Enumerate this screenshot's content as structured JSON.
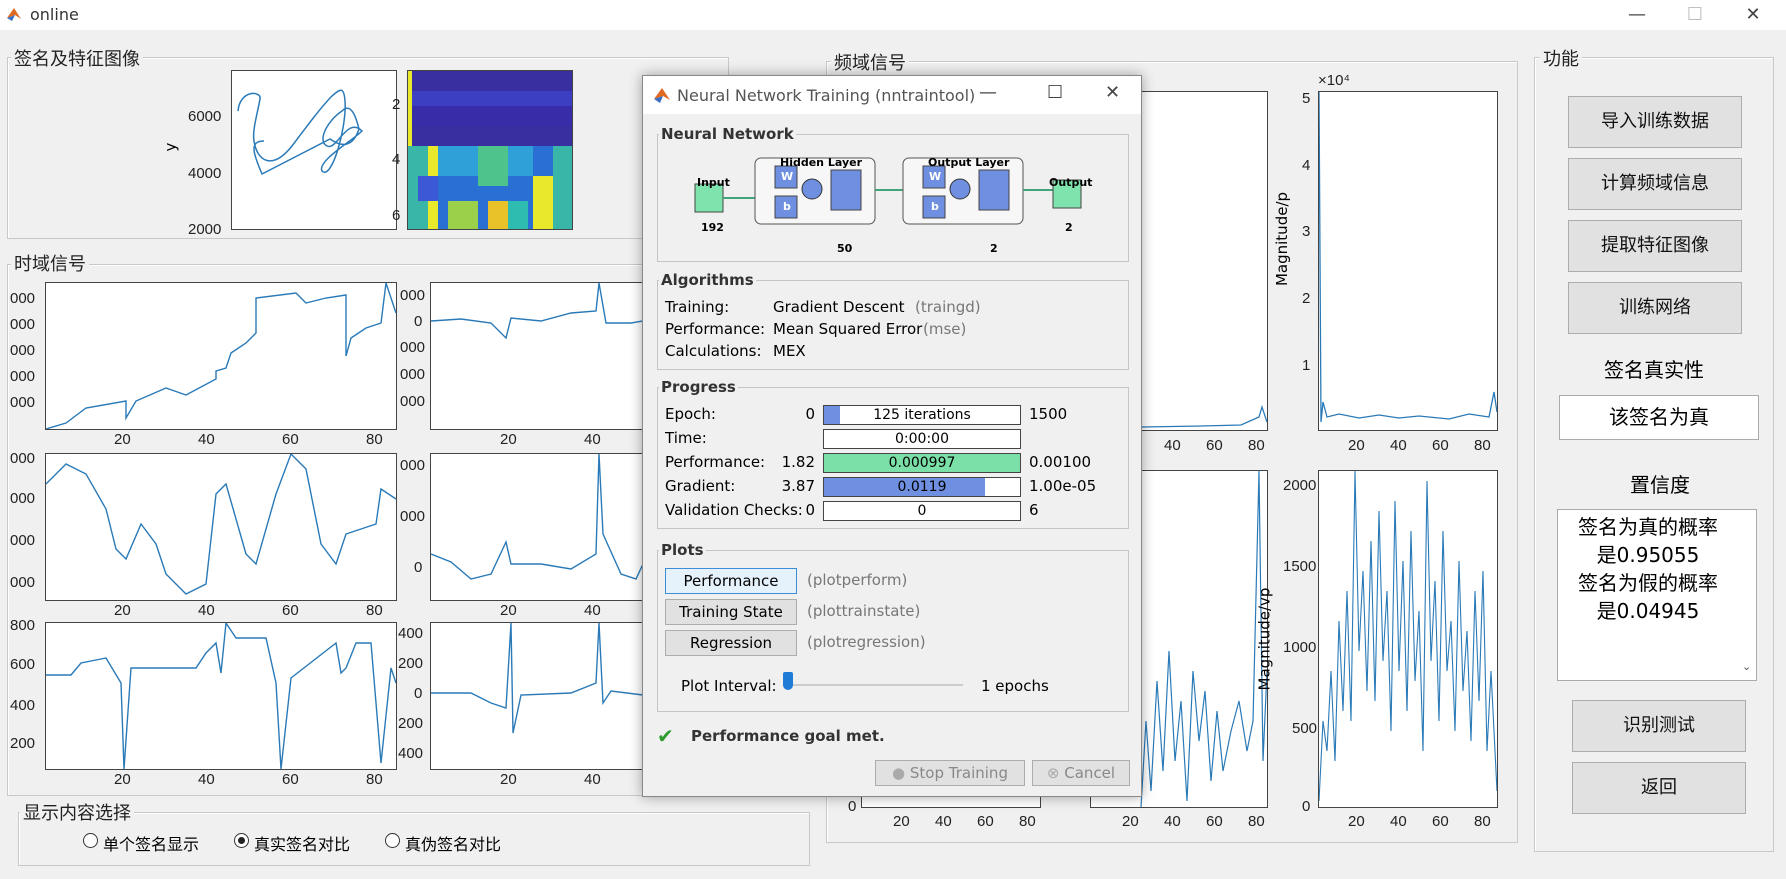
{
  "window": {
    "title": "online",
    "minimize": "—",
    "maximize": "☐",
    "close": "✕"
  },
  "panels": {
    "signature": "签名及特征图像",
    "time_signal": "时域信号",
    "freq_signal": "频域信号",
    "functions": "功能",
    "display": "显示内容选择"
  },
  "sig_axes": {
    "ylabel": "y",
    "yticks": [
      "6000",
      "4000",
      "2000"
    ]
  },
  "feature_axes": {
    "yticks": [
      "2",
      "4",
      "6"
    ]
  },
  "time_axes": {
    "xticks": [
      "20",
      "40",
      "60",
      "80"
    ],
    "row1_col1_yticks": [
      "000",
      "000",
      "000",
      "000",
      "000"
    ],
    "row1_col2_yticks": [
      "000",
      "0",
      "000",
      "000",
      "000"
    ],
    "row2_col1_yticks": [
      "000",
      "000",
      "000",
      "000"
    ],
    "row2_col2_yticks": [
      "000",
      "000",
      "0"
    ],
    "row3_col1_yticks": [
      "800",
      "600",
      "400",
      "200"
    ],
    "row3_col2_yticks": [
      "400",
      "200",
      "0",
      "200",
      "400"
    ]
  },
  "freq_axes": {
    "xticks": [
      "20",
      "40",
      "60",
      "80"
    ],
    "top_right_exp": "×10⁴",
    "top_right_yticks": [
      "5",
      "4",
      "3",
      "2",
      "1"
    ],
    "top_right_ylabel": "Magnitude/p",
    "bottom_right_yticks": [
      "2000",
      "1500",
      "1000",
      "500",
      "0"
    ],
    "bottom_right_ylabel": "Magnitude/vp",
    "bottom_left_ytick0": "0"
  },
  "functions": {
    "import_btn": "导入训练数据",
    "freq_btn": "计算频域信息",
    "feature_btn": "提取特征图像",
    "train_btn": "训练网络",
    "authenticity_label": "签名真实性",
    "authenticity_value": "该签名为真",
    "confidence_label": "置信度",
    "confidence_lines": [
      "签名为真的概率",
      "是0.95055",
      "签名为假的概率",
      "是0.04945"
    ],
    "test_btn": "识别测试",
    "back_btn": "返回"
  },
  "display_options": [
    "单个签名显示",
    "真实签名对比",
    "真伪签名对比"
  ],
  "display_selected": 1,
  "nntraintool": {
    "title": "Neural Network Training (nntraintool)",
    "nn_section": "Neural Network",
    "diagram": {
      "input": "Input",
      "input_n": "192",
      "hidden": "Hidden Layer",
      "hidden_n": "50",
      "output_layer": "Output Layer",
      "output_layer_n": "2",
      "output": "Output",
      "output_n": "2",
      "w": "W",
      "b": "b"
    },
    "alg_section": "Algorithms",
    "algorithms": [
      {
        "label": "Training:",
        "value": "Gradient Descent",
        "fn": "(traingd)"
      },
      {
        "label": "Performance:",
        "value": "Mean Squared Error",
        "fn": "(mse)"
      },
      {
        "label": "Calculations:",
        "value": "MEX",
        "fn": ""
      }
    ],
    "progress_section": "Progress",
    "progress": [
      {
        "label": "Epoch:",
        "start": "0",
        "bar": "125 iterations",
        "end": "1500",
        "fill": 0.083,
        "color": "#6f8fe0"
      },
      {
        "label": "Time:",
        "start": "",
        "bar": "0:00:00",
        "end": "",
        "fill": 0,
        "color": "#6f8fe0"
      },
      {
        "label": "Performance:",
        "start": "1.82",
        "bar": "0.000997",
        "end": "0.00100",
        "fill": 1.0,
        "color": "#7be0a8"
      },
      {
        "label": "Gradient:",
        "start": "3.87",
        "bar": "0.0119",
        "end": "1.00e-05",
        "fill": 0.82,
        "color": "#6f8fe0"
      },
      {
        "label": "Validation Checks:",
        "start": "0",
        "bar": "0",
        "end": "6",
        "fill": 0,
        "color": "#6f8fe0"
      }
    ],
    "plots_section": "Plots",
    "plots": [
      {
        "label": "Performance",
        "fn": "(plotperform)"
      },
      {
        "label": "Training State",
        "fn": "(plottrainstate)"
      },
      {
        "label": "Regression",
        "fn": "(plotregression)"
      }
    ],
    "plot_interval_label": "Plot Interval:",
    "plot_interval_value": "1 epochs",
    "status": "Performance goal met.",
    "stop_btn": "Stop Training",
    "cancel_btn": "Cancel"
  }
}
